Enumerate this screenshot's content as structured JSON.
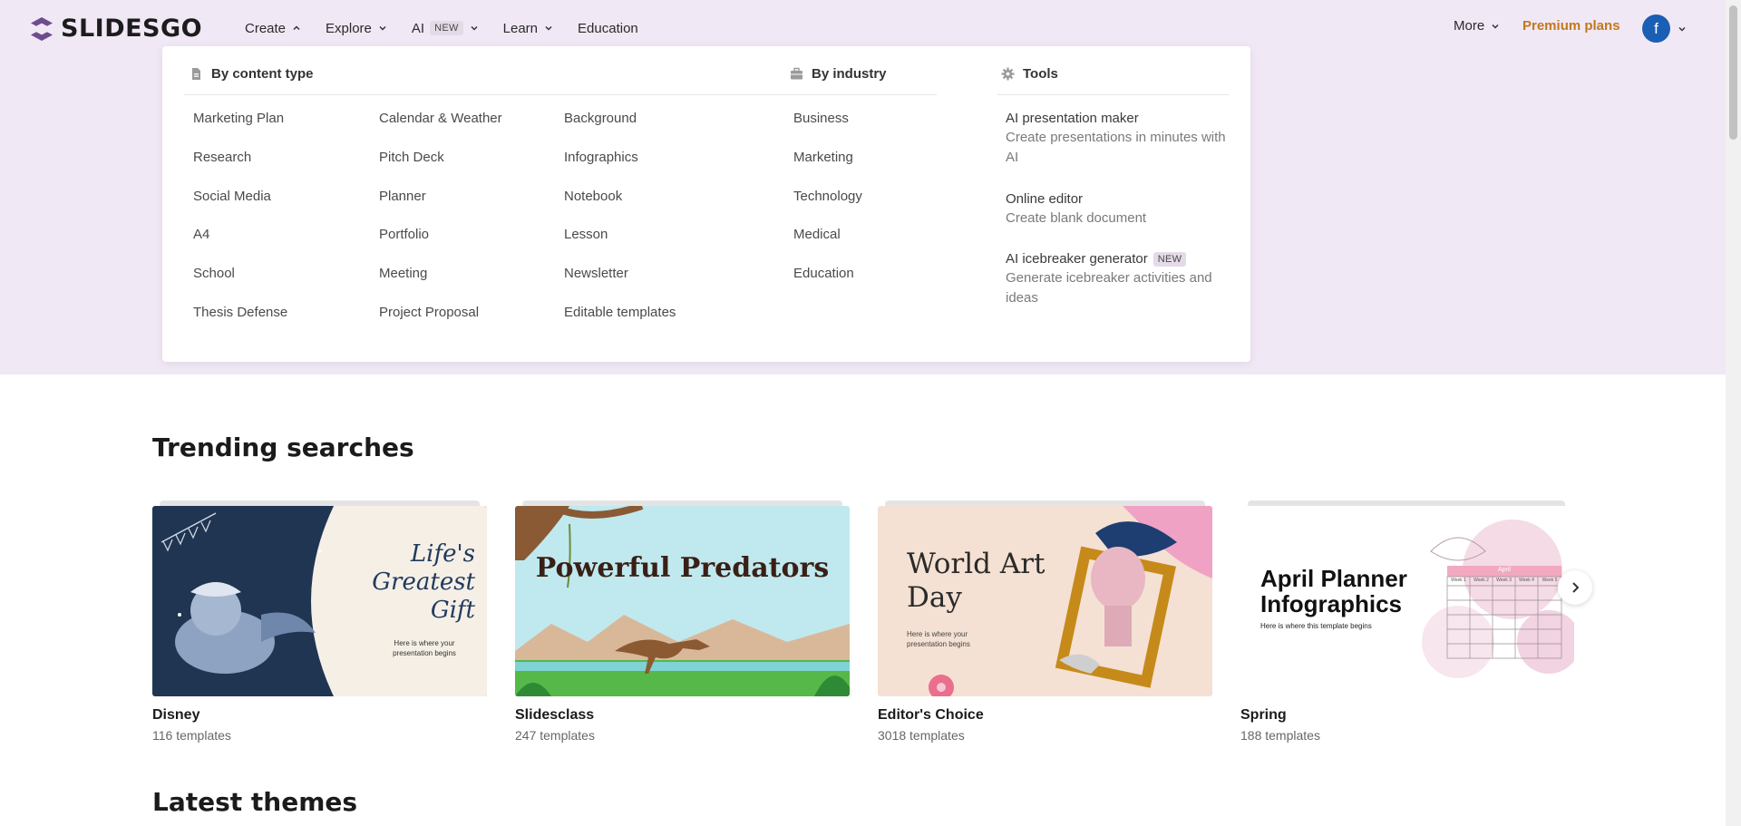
{
  "header": {
    "logo_text": "SLIDESGO",
    "nav": [
      {
        "label": "Create"
      },
      {
        "label": "Explore"
      },
      {
        "label": "AI",
        "badge": "NEW"
      },
      {
        "label": "Learn"
      },
      {
        "label": "Education"
      }
    ],
    "more_label": "More",
    "premium_label": "Premium plans",
    "avatar_initial": "f"
  },
  "dropdown": {
    "content_type": {
      "heading": "By content type",
      "columns": [
        [
          "Marketing Plan",
          "Research",
          "Social Media",
          "A4",
          "School",
          "Thesis Defense"
        ],
        [
          "Calendar & Weather",
          "Pitch Deck",
          "Planner",
          "Portfolio",
          "Meeting",
          "Project Proposal"
        ],
        [
          "Background",
          "Infographics",
          "Notebook",
          "Lesson",
          "Newsletter",
          "Editable templates"
        ]
      ]
    },
    "industry": {
      "heading": "By industry",
      "items": [
        "Business",
        "Marketing",
        "Technology",
        "Medical",
        "Education"
      ]
    },
    "tools": {
      "heading": "Tools",
      "items": [
        {
          "title": "AI presentation maker",
          "desc": "Create presentations in minutes with AI"
        },
        {
          "title": "Online editor",
          "desc": "Create blank document"
        },
        {
          "title": "AI icebreaker generator",
          "badge": "NEW",
          "desc": "Generate icebreaker activities and ideas"
        }
      ]
    }
  },
  "trending": {
    "title": "Trending searches",
    "cards": [
      {
        "name": "Disney",
        "count": "116 templates",
        "thumb_title": "Life's Greatest Gift",
        "thumb_sub": "Here is where your presentation begins"
      },
      {
        "name": "Slidesclass",
        "count": "247 templates",
        "thumb_title": "Powerful Predators"
      },
      {
        "name": "Editor's Choice",
        "count": "3018 templates",
        "thumb_title": "World Art Day",
        "thumb_sub": "Here is where your presentation begins"
      },
      {
        "name": "Spring",
        "count": "188 templates",
        "thumb_title": "April Planner Infographics",
        "thumb_sub": "Here is where this template begins",
        "calendar_month": "April",
        "weeks": [
          "Week 1",
          "Week 2",
          "Week 3",
          "Week 4",
          "Week 5"
        ]
      }
    ]
  },
  "latest": {
    "title": "Latest themes"
  },
  "colors": {
    "hero_band": "#f1e8f5",
    "premium": "#c2781c",
    "avatar": "#1a5fb4",
    "logo": "#6d4c8f"
  }
}
